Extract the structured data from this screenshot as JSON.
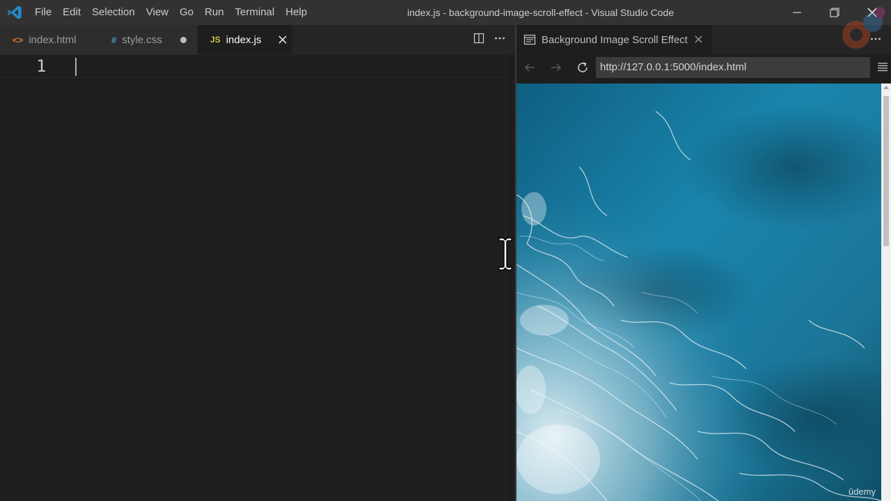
{
  "window": {
    "title": "index.js - background-image-scroll-effect - Visual Studio Code",
    "menu": [
      "File",
      "Edit",
      "Selection",
      "View",
      "Go",
      "Run",
      "Terminal",
      "Help"
    ]
  },
  "editor": {
    "tabs": [
      {
        "label": "index.html",
        "icon": "<>",
        "icon_color": "#e37933",
        "state": "none"
      },
      {
        "label": "style.css",
        "icon": "#",
        "icon_color": "#519aba",
        "state": "dirty"
      },
      {
        "label": "index.js",
        "icon": "JS",
        "icon_color": "#cbcb41",
        "state": "close"
      }
    ],
    "active_tab": "index.js",
    "line_numbers": [
      "1"
    ]
  },
  "preview": {
    "tab_title": "Background Image Scroll Effect",
    "url": "http://127.0.0.1:5000/index.html",
    "watermark": "ūdemy"
  },
  "colors": {
    "titlebar": "#323233",
    "editor_bg": "#1e1e1e",
    "vscode_blue": "#2489ca",
    "ocean_deep": "#0d4d68",
    "ocean_mid": "#1a7aa0",
    "foam": "#e8f2f5"
  }
}
